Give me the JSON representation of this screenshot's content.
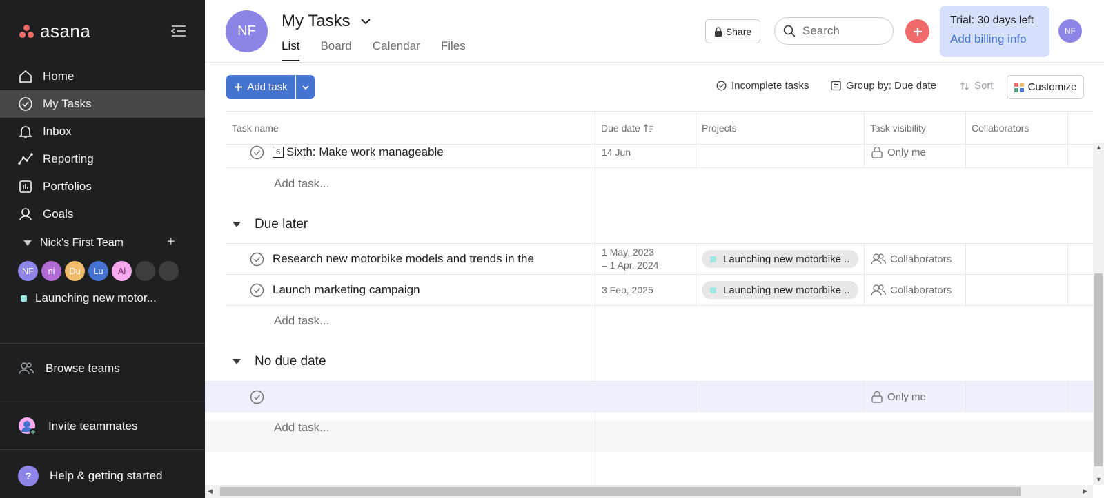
{
  "app": {
    "logo_text": "asana"
  },
  "sidebar": {
    "items": [
      {
        "label": "Home"
      },
      {
        "label": "My Tasks"
      },
      {
        "label": "Inbox"
      },
      {
        "label": "Reporting"
      },
      {
        "label": "Portfolios"
      },
      {
        "label": "Goals"
      }
    ],
    "team": {
      "name": "Nick's First Team",
      "members": [
        {
          "initials": "NF",
          "color": "#8d84e8"
        },
        {
          "initials": "ni",
          "color": "#b36bd4"
        },
        {
          "initials": "Du",
          "color": "#f1bd6c"
        },
        {
          "initials": "Lu",
          "color": "#4573d2"
        },
        {
          "initials": "Al",
          "color": "#f9aaef"
        },
        {
          "initials": "",
          "color": "#3d3e40"
        },
        {
          "initials": "",
          "color": "#3d3e40"
        }
      ]
    },
    "project": {
      "label": "Launching new motor...",
      "color": "#9ee7e3"
    },
    "browse_teams": "Browse teams",
    "invite": "Invite teammates",
    "help": "Help & getting started"
  },
  "header": {
    "avatar": "NF",
    "title": "My Tasks",
    "tabs": [
      "List",
      "Board",
      "Calendar",
      "Files"
    ],
    "share": "Share",
    "search_placeholder": "Search",
    "trial_line1": "Trial: 30 days left",
    "trial_line2": "Add billing info",
    "user_avatar": "NF"
  },
  "toolbar": {
    "add_task": "Add task",
    "incomplete": "Incomplete tasks",
    "group_by": "Group by: Due date",
    "sort": "Sort",
    "customize": "Customize"
  },
  "table": {
    "columns": [
      "Task name",
      "Due date",
      "Projects",
      "Task visibility",
      "Collaborators"
    ],
    "add_task_label": "Add task...",
    "top_task": {
      "badge": "6",
      "name": "Sixth: Make work manageable",
      "due": "14 Jun",
      "visibility": "Only me"
    },
    "sections": [
      {
        "title": "Due later",
        "tasks": [
          {
            "name": "Research new motorbike models and trends in the",
            "due_line1": "1 May, 2023",
            "due_line2": "– 1 Apr, 2024",
            "project": "Launching new motorbike ...",
            "visibility": "Collaborators"
          },
          {
            "name": "Launch marketing campaign",
            "due_line1": "3 Feb, 2025",
            "project": "Launching new motorbike ...",
            "visibility": "Collaborators"
          }
        ]
      },
      {
        "title": "No due date",
        "tasks": [
          {
            "name": "",
            "visibility": "Only me"
          }
        ]
      }
    ]
  },
  "colors": {
    "accent": "#4573d2",
    "sidebar_bg": "#1e1f21",
    "coral": "#f06a6a",
    "project_dot": "#9ee7e3"
  }
}
